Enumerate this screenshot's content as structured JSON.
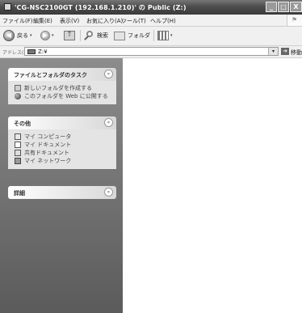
{
  "window": {
    "title": "'CG-NSC2100GT (192.168.1.210)' の Public (Z:)",
    "minimize_glyph": "_",
    "maximize_glyph": "□",
    "close_glyph": "X"
  },
  "menu": [
    "ファイル(F)",
    "編集(E)",
    "表示(V)",
    "お気に入り(A)",
    "ツール(T)",
    "ヘルプ(H)"
  ],
  "toolbar": {
    "back_label": "戻る",
    "back_glyph": "◀",
    "forward_glyph": "▶",
    "up_glyph": "↑",
    "search_label": "検索",
    "folders_label": "フォルダ",
    "dropdown_glyph": "▾"
  },
  "address": {
    "label": "アドレス(D)",
    "value": "Z:¥",
    "dropdown_glyph": "▾",
    "go_glyph": "➔",
    "go_label": "移動"
  },
  "task_pane": {
    "panels": [
      {
        "title": "ファイルとフォルダのタスク",
        "chevron": "«",
        "items": [
          "新しいフォルダを作成する",
          "このフォルダを Web に公開する"
        ]
      },
      {
        "title": "その他",
        "chevron": "«",
        "items": [
          "マイ コンピュータ",
          "マイ ドキュメント",
          "共有ドキュメント",
          "マイ ネットワーク"
        ]
      },
      {
        "title": "詳細",
        "chevron": "»",
        "items": []
      }
    ]
  }
}
